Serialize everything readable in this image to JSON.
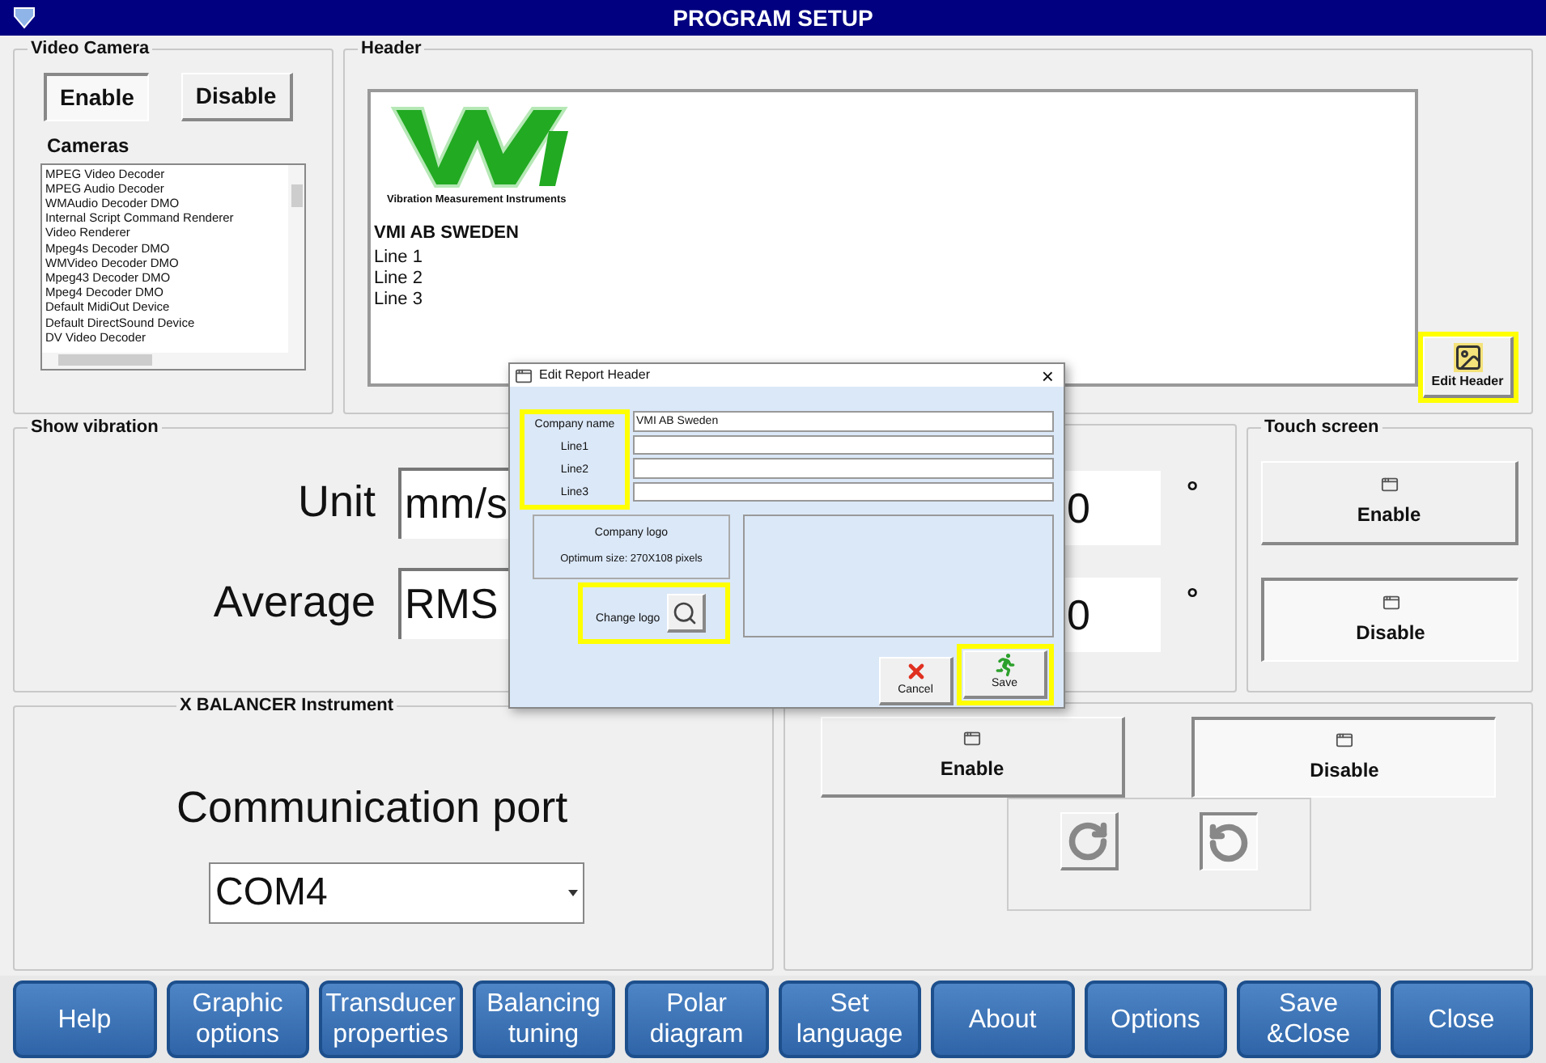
{
  "window": {
    "title": "PROGRAM SETUP"
  },
  "video_camera": {
    "title": "Video Camera",
    "buttons": [
      {
        "label": "Enable",
        "selected": true
      },
      {
        "label": "Disable",
        "selected": false
      }
    ],
    "cameras_label": "Cameras",
    "cameras": [
      "MPEG Video Decoder",
      "MPEG Audio Decoder",
      "WMAudio Decoder DMO",
      "Internal Script Command Renderer",
      "Video Renderer",
      "Mpeg4s Decoder DMO",
      "WMVideo Decoder DMO",
      "Mpeg43 Decoder DMO",
      "Mpeg4 Decoder DMO",
      "Default MidiOut Device",
      "Default DirectSound Device",
      "DV Video Decoder"
    ]
  },
  "header": {
    "title": "Header",
    "logo_caption": "Vibration Measurement Instruments",
    "company": "VMI AB SWEDEN",
    "lines": [
      "Line 1",
      "Line 2",
      "Line 3"
    ],
    "edit_button": "Edit Header"
  },
  "show_vibration": {
    "title": "Show vibration",
    "rows": [
      {
        "label": "Unit",
        "value": "mm/s"
      },
      {
        "label": "Average",
        "value": "RMS"
      }
    ]
  },
  "angle_fields": [
    {
      "value": "0",
      "unit": "°"
    },
    {
      "value": "0",
      "unit": "°"
    }
  ],
  "touch_screen": {
    "title": "Touch screen",
    "buttons": [
      {
        "label": "Enable",
        "selected": false
      },
      {
        "label": "Disable",
        "selected": true
      }
    ]
  },
  "instrument": {
    "title": "X BALANCER Instrument",
    "label": "Communication port",
    "port": "COM4"
  },
  "angle_indicator": {
    "buttons": [
      {
        "label": "Enable",
        "selected": false
      },
      {
        "label": "Disable",
        "selected": true
      }
    ],
    "rotation": [
      {
        "kind": "clockwise",
        "selected": false
      },
      {
        "kind": "counterclockwise",
        "selected": true
      }
    ]
  },
  "dialog": {
    "title": "Edit Report Header",
    "close": "×",
    "fields": [
      {
        "label": "Company name",
        "value": "VMI AB Sweden"
      },
      {
        "label": "Line1"
      },
      {
        "label": "Line2"
      },
      {
        "label": "Line3"
      }
    ],
    "logo_title": "Company logo",
    "logo_hint": "Optimum size: 270X108 pixels",
    "change_logo": "Change logo",
    "cancel": "Cancel",
    "save": "Save"
  },
  "toolbar": [
    "Help",
    "Graphic options",
    "Transducer properties",
    "Balancing tuning",
    "Polar diagram",
    "Set language",
    "About",
    "Options",
    "Save &Close",
    "Close"
  ]
}
